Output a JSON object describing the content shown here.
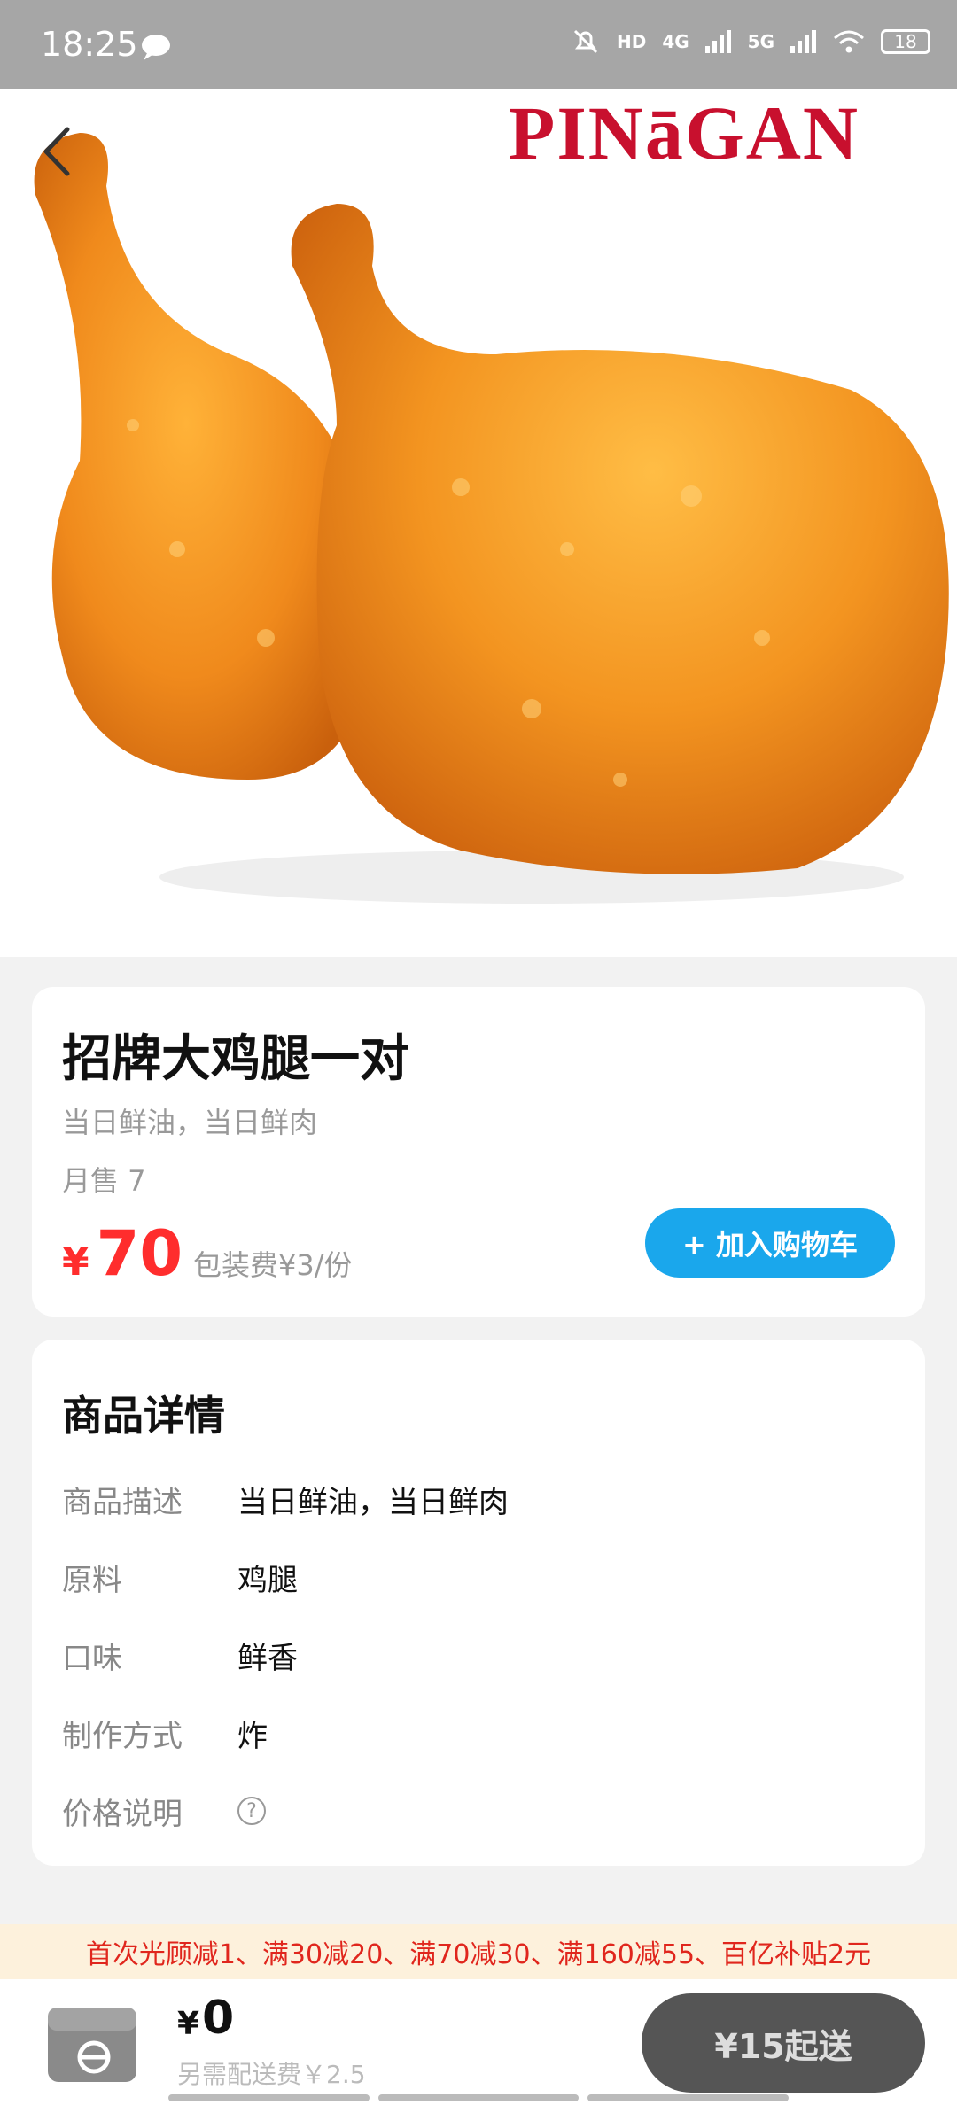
{
  "status": {
    "time": "18:25",
    "net1": "4G",
    "net2": "5G",
    "battery": "18"
  },
  "hero": {
    "brand": "PINāGAN"
  },
  "product": {
    "title": "招牌大鸡腿一对",
    "subtitle": "当日鲜油，当日鲜肉",
    "monthly_sales": "月售 7",
    "currency": "¥",
    "price": "70",
    "packaging_fee": "包装费¥3/份",
    "add_to_cart_label": "+ 加入购物车"
  },
  "details": {
    "title": "商品详情",
    "rows": [
      {
        "label": "商品描述",
        "value": "当日鲜油，当日鲜肉"
      },
      {
        "label": "原料",
        "value": "鸡腿"
      },
      {
        "label": "口味",
        "value": "鲜香"
      },
      {
        "label": "制作方式",
        "value": "炸"
      },
      {
        "label": "价格说明",
        "value": "?"
      }
    ]
  },
  "promo": {
    "text": "首次光顾减1、满30减20、满70减30、满160减55、百亿补贴2元"
  },
  "bottom": {
    "currency": "¥",
    "total": "0",
    "delivery_note": "另需配送费￥2.5",
    "checkout_label": "¥15起送"
  },
  "colors": {
    "accent": "#1aa7ec",
    "price": "#ff2d2d",
    "brand": "#c8102e",
    "promo_bg": "#fdf1dc"
  }
}
